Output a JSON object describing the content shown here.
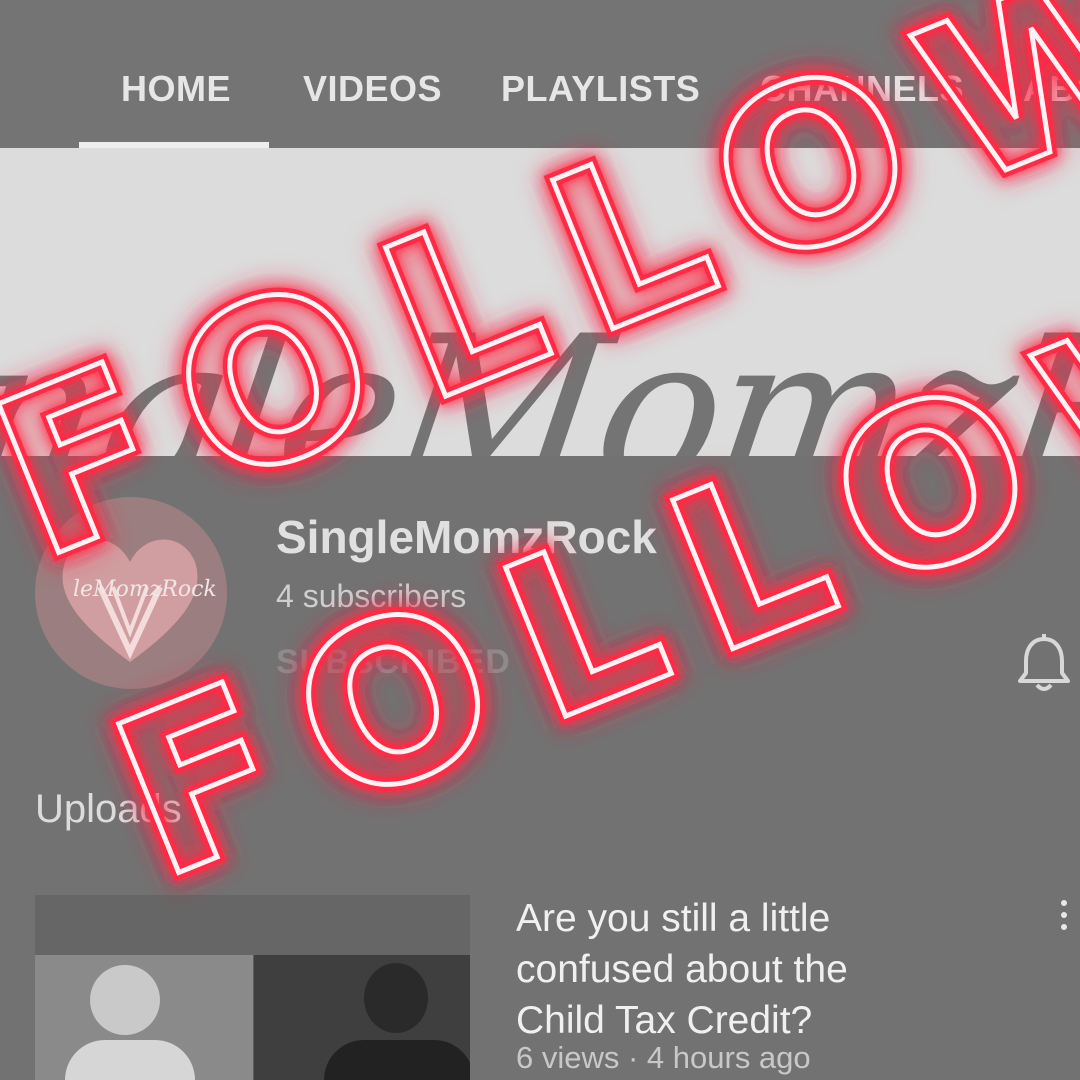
{
  "tabs": [
    {
      "label": "HOME",
      "active": true
    },
    {
      "label": "VIDEOS"
    },
    {
      "label": "PLAYLISTS"
    },
    {
      "label": "CHANNELS"
    },
    {
      "label": "ABO"
    }
  ],
  "banner": {
    "text": "ingleMomzRoc"
  },
  "channel": {
    "name": "SingleMomzRock",
    "subscribers": "4 subscribers",
    "subscribe_label": "SUBSCRIBED",
    "avatar_text": "leMomzRock",
    "bell_icon": "bell-icon"
  },
  "section": {
    "title": "Uploads"
  },
  "video": {
    "title": "Are you still a little confused about the Child Tax Credit?",
    "meta": "6 views · 4 hours ago",
    "menu_icon": "more-vert-icon"
  },
  "overlay": {
    "word_top": "FOLLOW",
    "word_bottom": "FOLLOW",
    "neon_color": "#ff2a45",
    "core_color": "#fff2f4"
  }
}
